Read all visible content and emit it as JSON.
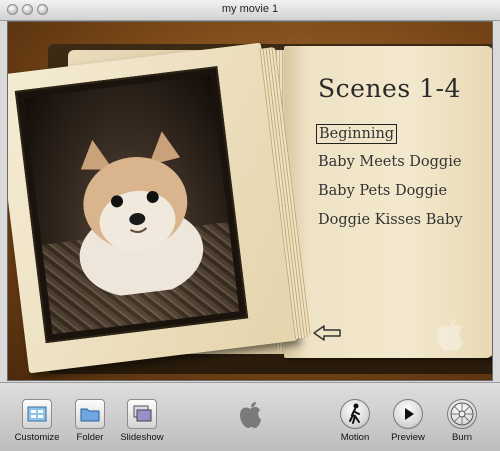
{
  "window": {
    "title": "my movie 1"
  },
  "menu_page": {
    "title": "Scenes 1-4",
    "scenes": [
      {
        "label": "Beginning",
        "selected": true
      },
      {
        "label": "Baby Meets Doggie",
        "selected": false
      },
      {
        "label": "Baby Pets Doggie",
        "selected": false
      },
      {
        "label": "Doggie Kisses Baby",
        "selected": false
      }
    ],
    "back_icon": "left-arrow-icon",
    "watermark_icon": "apple-icon"
  },
  "toolbar": {
    "customize": "Customize",
    "folder": "Folder",
    "slideshow": "Slideshow",
    "motion": "Motion",
    "preview": "Preview",
    "burn": "Burn",
    "center_icon": "apple-icon"
  },
  "colors": {
    "stage_background": "#7a4818",
    "page": "#f3e8cd",
    "toolbar": "#d0d0d0"
  }
}
